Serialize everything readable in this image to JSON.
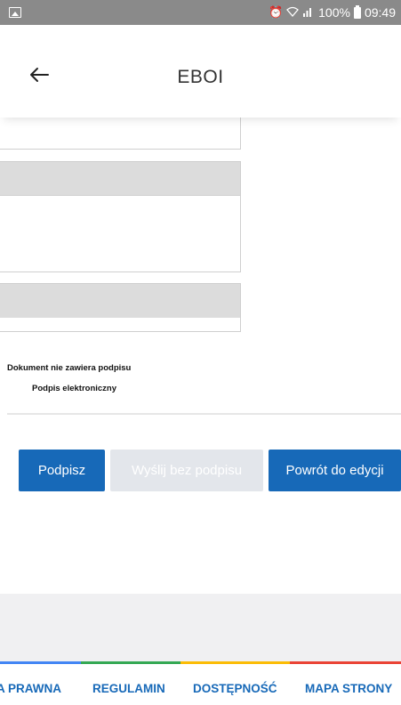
{
  "status_bar": {
    "battery": "100%",
    "time": "09:49",
    "icons": [
      "image-notification-icon",
      "alarm-icon",
      "wifi-icon",
      "signal-icon",
      "battery-icon"
    ]
  },
  "header": {
    "title": "EBOI",
    "back_icon": "arrow-left-icon"
  },
  "signature": {
    "status": "Dokument nie zawiera podpisu",
    "type": "Podpis elektroniczny"
  },
  "actions": {
    "sign_label": "Podpisz",
    "send_unsigned_label": "Wyślij bez podpisu",
    "back_to_edit_label": "Powrót do edycji"
  },
  "footer": {
    "links": [
      {
        "label": "A PRAWNA"
      },
      {
        "label": "REGULAMIN"
      },
      {
        "label": "DOSTĘPNOŚĆ"
      },
      {
        "label": "MAPA STRONY"
      }
    ],
    "stripe_colors": [
      "#4285f4",
      "#34a853",
      "#fbbc05",
      "#ea4335"
    ]
  },
  "colors": {
    "primary": "#1769b8",
    "disabled": "#e3e6eb",
    "status_bar": "#8a8a8a"
  }
}
